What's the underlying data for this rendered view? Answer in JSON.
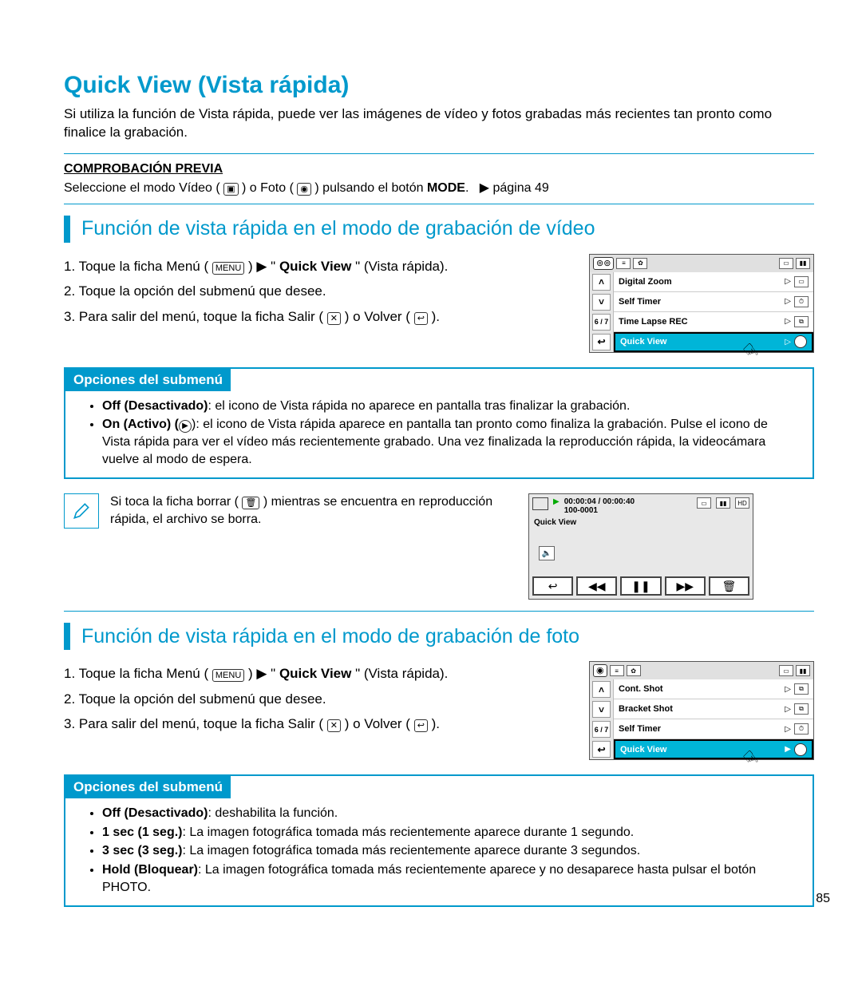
{
  "page_title": "Quick View (Vista rápida)",
  "intro": "Si utiliza la función de Vista rápida, puede ver las imágenes de vídeo y fotos grabadas más recientes tan pronto como finalice la grabación.",
  "precheck": {
    "title": "COMPROBACIÓN PREVIA",
    "text_before": "Seleccione el modo Vídeo (",
    "text_mid": ") o Foto (",
    "text_after": ") pulsando el botón ",
    "mode": "MODE",
    "page_ref": "▶ página 49"
  },
  "video": {
    "heading": "Función de vista rápida en el modo de grabación de vídeo",
    "step1a": "1. Toque la ficha Menú (",
    "step1_menu": "MENU",
    "step1b": ") ▶ \"",
    "step1_qv": "Quick View",
    "step1c": "\" (Vista rápida).",
    "step2": "2. Toque la opción del submenú que desee.",
    "step3a": "3. Para salir del menú, toque la ficha Salir (",
    "step3b": ") o Volver (",
    "step3c": ")."
  },
  "menu_video": {
    "counter": "6 / 7",
    "items": [
      "Digital Zoom",
      "Self Timer",
      "Time Lapse REC",
      "Quick View"
    ]
  },
  "submenu_video": {
    "title": "Opciones del submenú",
    "off_bold": "Off (Desactivado)",
    "off_rest": ": el icono de Vista rápida no aparece en pantalla tras finalizar la grabación.",
    "on_bold": "On (Activo) (",
    "on_rest": "): el icono de Vista rápida aparece en pantalla tan pronto como finaliza la grabación. Pulse el icono de Vista rápida para ver el vídeo más recientemente grabado. Una vez finalizada la reproducción rápida, la videocámara vuelve al modo de espera."
  },
  "note": {
    "text_a": "Si toca la ficha borrar (",
    "text_b": ") mientras se encuentra en reproducción rápida, el archivo se borra."
  },
  "play_screen": {
    "time": "00:00:04 / 00:00:40",
    "file": "100-0001",
    "label": "Quick View"
  },
  "photo": {
    "heading": "Función de vista rápida en el modo de grabación de foto",
    "step1a": "1. Toque la ficha Menú (",
    "step1_menu": "MENU",
    "step1b": ") ▶ \"",
    "step1_qv": "Quick View",
    "step1c": "\" (Vista rápida).",
    "step2": "2. Toque la opción del submenú que desee.",
    "step3a": "3. Para salir del menú, toque la ficha Salir (",
    "step3b": ") o Volver (",
    "step3c": ")."
  },
  "menu_photo": {
    "counter": "6 / 7",
    "items": [
      "Cont. Shot",
      "Bracket Shot",
      "Self Timer",
      "Quick View"
    ]
  },
  "submenu_photo": {
    "title": "Opciones del submenú",
    "li1_b": "Off (Desactivado)",
    "li1": ": deshabilita la función.",
    "li2_b": "1 sec (1 seg.)",
    "li2": ": La imagen fotográfica tomada más recientemente aparece durante 1 segundo.",
    "li3_b": "3 sec (3 seg.)",
    "li3": ": La imagen fotográfica tomada más recientemente aparece durante 3 segundos.",
    "li4_b": "Hold (Bloquear)",
    "li4": ": La imagen fotográfica tomada más recientemente aparece y no desaparece hasta pulsar el botón PHOTO."
  },
  "page_number": "85"
}
